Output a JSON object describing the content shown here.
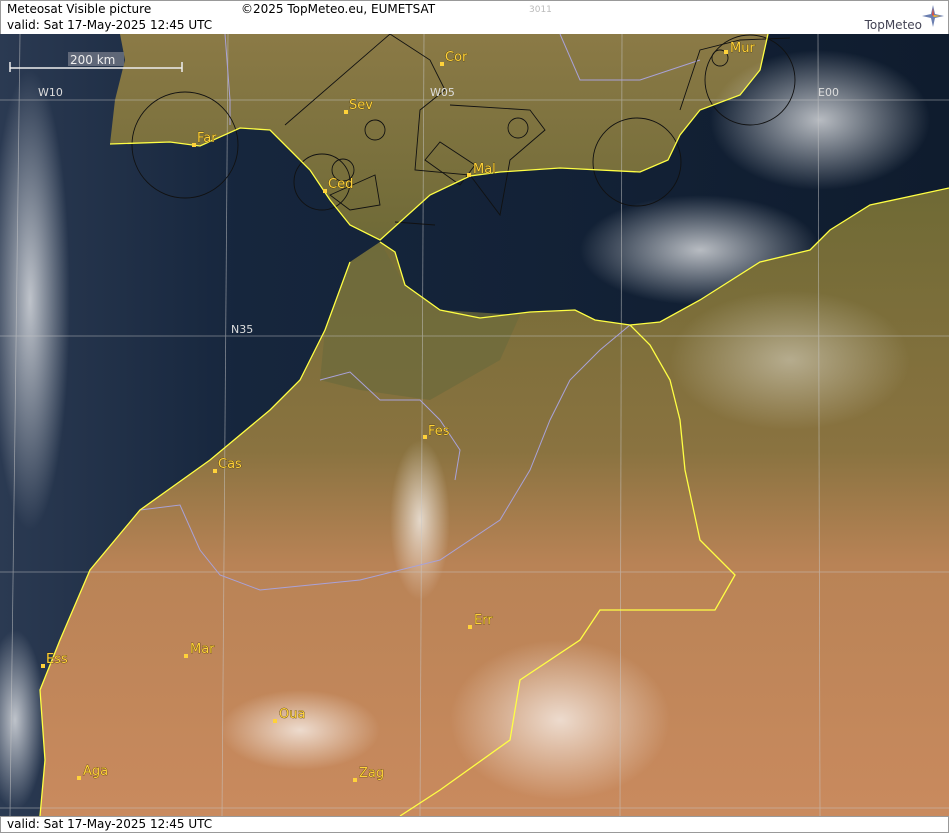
{
  "header": {
    "title": "Meteosat Visible picture",
    "valid": "valid:  Sat  17-May-2025  12:45 UTC",
    "copyright": "©2025 TopMeteo.eu, EUMETSAT",
    "code": "3011",
    "brand": "TopMeteo"
  },
  "footer": {
    "valid": "valid:  Sat  17-May-2025  12:45 UTC"
  },
  "map": {
    "scale_bar": "200 km",
    "grid_labels": {
      "w10": "W10",
      "w05": "W05",
      "e00": "E00",
      "n35": "N35"
    },
    "cities": {
      "cor": "Cor",
      "mur": "Mur",
      "sev": "Sev",
      "far": "Far",
      "ced": "Ced",
      "mal": "Mal",
      "fes": "Fes",
      "cas": "Cas",
      "err": "Err",
      "mar": "Mar",
      "ess": "Ess",
      "oua": "Oua",
      "aga": "Aga",
      "zag": "Zag"
    },
    "colors": {
      "sea": "#142236",
      "land_north": "#7a6a3c",
      "land_south": "#c9875a",
      "coastline": "#ffff44",
      "border": "#a9a2d8",
      "city": "#ffd23a"
    }
  }
}
